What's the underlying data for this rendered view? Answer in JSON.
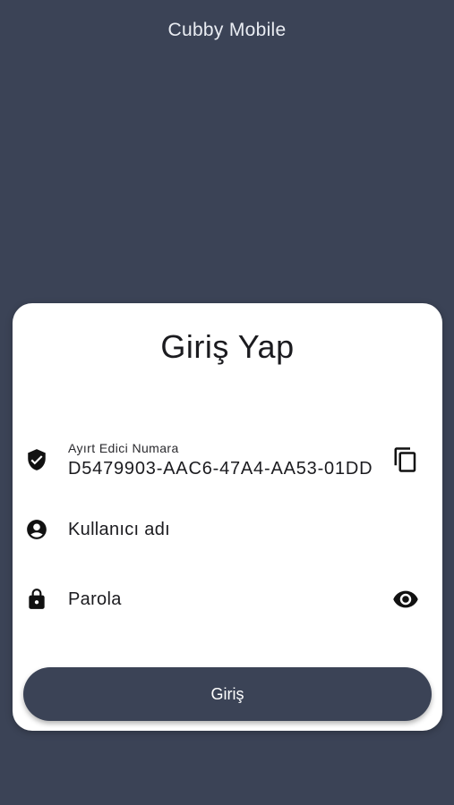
{
  "app": {
    "title": "Cubby Mobile"
  },
  "login_card": {
    "title": "Giriş Yap",
    "device_id": {
      "label": "Ayırt Edici Numara",
      "value": "D5479903-AAC6-47A4-AA53-01DD",
      "icon": "shield-check-icon",
      "action_icon": "copy-icon"
    },
    "username": {
      "placeholder": "Kullanıcı adı",
      "value": "",
      "icon": "account-circle-icon"
    },
    "password": {
      "placeholder": "Parola",
      "value": "",
      "icon": "lock-icon",
      "action_icon": "eye-icon"
    },
    "submit_label": "Giriş"
  },
  "colors": {
    "background": "#3b4356",
    "card": "#ffffff",
    "button": "#3b4356",
    "icon": "#111111"
  }
}
